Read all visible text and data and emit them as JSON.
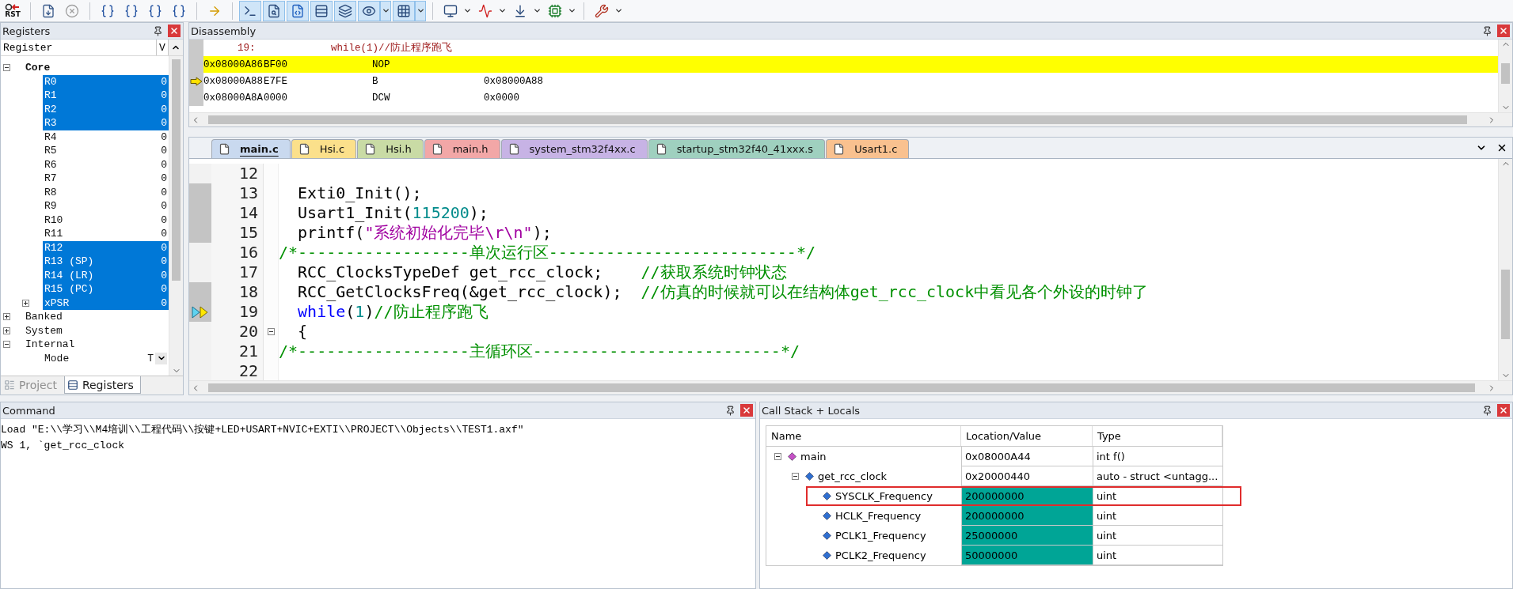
{
  "toolbar": [
    [
      {
        "kind": "rst",
        "label": "RST",
        "pressed": false
      }
    ],
    [
      {
        "kind": "reset",
        "pressed": false
      },
      {
        "kind": "stop",
        "pressed": false
      }
    ],
    [
      {
        "kind": "stepinto",
        "pressed": false
      },
      {
        "kind": "stepover",
        "pressed": false
      },
      {
        "kind": "stepout",
        "pressed": false
      },
      {
        "kind": "runcursor",
        "pressed": false
      }
    ],
    [
      {
        "kind": "shownext",
        "pressed": false
      }
    ],
    [
      {
        "kind": "command",
        "pressed": true
      },
      {
        "kind": "disassembly",
        "pressed": true
      },
      {
        "kind": "symbols",
        "pressed": true
      },
      {
        "kind": "registers",
        "pressed": true
      },
      {
        "kind": "callstack",
        "pressed": true
      },
      {
        "kind": "watch",
        "pressed": true
      },
      {
        "kind": "menu",
        "pressed": true
      },
      {
        "kind": "memory",
        "pressed": true
      },
      {
        "kind": "menu",
        "pressed": true
      }
    ],
    [
      {
        "kind": "serial",
        "pressed": false
      },
      {
        "kind": "menu",
        "pressed": false
      },
      {
        "kind": "analysis",
        "pressed": false
      },
      {
        "kind": "menu",
        "pressed": false
      },
      {
        "kind": "trace",
        "pressed": false
      },
      {
        "kind": "menu",
        "pressed": false
      },
      {
        "kind": "viewer",
        "pressed": false
      },
      {
        "kind": "menu",
        "pressed": false
      }
    ],
    [
      {
        "kind": "tools",
        "pressed": false
      },
      {
        "kind": "menu",
        "pressed": false
      }
    ]
  ],
  "registers": {
    "title": "Registers",
    "columns": [
      "Register",
      "V"
    ],
    "tree": [
      {
        "label": "Core",
        "selected": false,
        "expanded": true,
        "children": [
          {
            "label": "R0",
            "value": "0",
            "kind": "value",
            "selected": true
          },
          {
            "label": "R1",
            "value": "0",
            "kind": "value",
            "selected": true
          },
          {
            "label": "R2",
            "value": "0",
            "kind": "value",
            "selected": true
          },
          {
            "label": "R3",
            "value": "0",
            "kind": "value",
            "selected": true
          },
          {
            "label": "R4",
            "value": "0",
            "kind": "value",
            "selected": false
          },
          {
            "label": "R5",
            "value": "0",
            "kind": "value",
            "selected": false
          },
          {
            "label": "R6",
            "value": "0",
            "kind": "value",
            "selected": false
          },
          {
            "label": "R7",
            "value": "0",
            "kind": "value",
            "selected": false
          },
          {
            "label": "R8",
            "value": "0",
            "kind": "value",
            "selected": false
          },
          {
            "label": "R9",
            "value": "0",
            "kind": "value",
            "selected": false
          },
          {
            "label": "R10",
            "value": "0",
            "kind": "value",
            "selected": false
          },
          {
            "label": "R11",
            "value": "0",
            "kind": "value",
            "selected": false
          },
          {
            "label": "R12",
            "value": "0",
            "kind": "value",
            "selected": true
          },
          {
            "label": "R13 (SP)",
            "value": "0",
            "kind": "value",
            "selected": true
          },
          {
            "label": "R14 (LR)",
            "value": "0",
            "kind": "value",
            "selected": true
          },
          {
            "label": "R15 (PC)",
            "value": "0",
            "kind": "value",
            "selected": true
          },
          {
            "label": "xPSR",
            "value": "0",
            "kind": "value",
            "selected": true,
            "expanded": false
          }
        ]
      },
      {
        "label": "Banked",
        "selected": false,
        "expanded": false
      },
      {
        "label": "System",
        "selected": false,
        "expanded": false
      },
      {
        "label": "Internal",
        "selected": false,
        "expanded": true,
        "children": [
          {
            "label": "Mode",
            "value": "T",
            "kind": "dropdown",
            "selected": false
          }
        ]
      }
    ],
    "tabs": [
      {
        "label": "Project",
        "selected": false
      },
      {
        "label": "Registers",
        "selected": true
      }
    ]
  },
  "disassembly": {
    "title": "Disassembly",
    "source": {
      "line": "19:",
      "code": "while(1)//防止程序跑飞"
    },
    "rows": [
      {
        "address": "0x08000A86",
        "opcode": "BF00",
        "mnemonic": "NOP",
        "highlighted": true,
        "current": false
      },
      {
        "address": "0x08000A88",
        "opcode": "E7FE",
        "mnemonic": "B",
        "operand": "0x08000A88",
        "highlighted": false,
        "current": true
      },
      {
        "address": "0x08000A8A",
        "opcode": "0000",
        "mnemonic": "DCW",
        "operand": "0x0000",
        "highlighted": false,
        "current": false
      }
    ]
  },
  "editor": {
    "tabs": [
      {
        "label": "main.c",
        "color": "#c9d9ef",
        "selected": true
      },
      {
        "label": "Hsi.c",
        "color": "#fbe08b",
        "selected": false
      },
      {
        "label": "Hsi.h",
        "color": "#c9dba5",
        "selected": false
      },
      {
        "label": "main.h",
        "color": "#f2a7a7",
        "selected": false
      },
      {
        "label": "system_stm32f4xx.c",
        "color": "#c7b3e5",
        "selected": false
      },
      {
        "label": "startup_stm32f40_41xxx.s",
        "color": "#9fd0bf",
        "selected": false
      },
      {
        "label": "Usart1.c",
        "color": "#f9c18f",
        "selected": false
      }
    ],
    "lines": [
      {
        "number": "12",
        "executable": false,
        "current": false,
        "fold": false
      },
      {
        "number": "13",
        "executable": true,
        "current": false,
        "fold": false,
        "segments": [
          {
            "text": "  Exti0_Init();",
            "kind": "plain"
          }
        ]
      },
      {
        "number": "14",
        "executable": true,
        "current": false,
        "fold": false,
        "segments": [
          {
            "text": "  Usart1_Init(",
            "kind": "plain"
          },
          {
            "text": "115200",
            "kind": "number"
          },
          {
            "text": ");",
            "kind": "plain"
          }
        ]
      },
      {
        "number": "15",
        "executable": true,
        "current": false,
        "fold": false,
        "segments": [
          {
            "text": "  printf(",
            "kind": "plain"
          },
          {
            "text": "\"系统初始化完毕\\r\\n\"",
            "kind": "string"
          },
          {
            "text": ");",
            "kind": "plain"
          }
        ]
      },
      {
        "number": "16",
        "executable": false,
        "current": false,
        "fold": false,
        "segments": [
          {
            "text": "/*------------------单次运行区--------------------------*/",
            "kind": "comment"
          }
        ]
      },
      {
        "number": "17",
        "executable": false,
        "current": false,
        "fold": false,
        "segments": [
          {
            "text": "  RCC_ClocksTypeDef get_rcc_clock;    ",
            "kind": "plain"
          },
          {
            "text": "//获取系统时钟状态",
            "kind": "comment"
          }
        ]
      },
      {
        "number": "18",
        "executable": true,
        "current": false,
        "fold": false,
        "segments": [
          {
            "text": "  RCC_GetClocksFreq(&get_rcc_clock);  ",
            "kind": "plain"
          },
          {
            "text": "//仿真的时候就可以在结构体get_rcc_clock中看见各个外设的时钟了",
            "kind": "comment"
          }
        ]
      },
      {
        "number": "19",
        "executable": true,
        "current": true,
        "fold": false,
        "segments": [
          {
            "text": "  while",
            "kind": "keyword"
          },
          {
            "text": "(",
            "kind": "plain"
          },
          {
            "text": "1",
            "kind": "number"
          },
          {
            "text": ")",
            "kind": "plain"
          },
          {
            "text": "//防止程序跑飞",
            "kind": "comment"
          }
        ]
      },
      {
        "number": "20",
        "executable": false,
        "current": false,
        "fold": true,
        "segments": [
          {
            "text": "  {",
            "kind": "plain"
          }
        ]
      },
      {
        "number": "21",
        "executable": false,
        "current": false,
        "fold": false,
        "segments": [
          {
            "text": "/*------------------主循环区--------------------------*/",
            "kind": "comment"
          }
        ]
      },
      {
        "number": "22",
        "executable": false,
        "current": false,
        "fold": false
      }
    ]
  },
  "command": {
    "title": "Command",
    "lines": [
      "Load \"E:\\\\学习\\\\M4培训\\\\工程代码\\\\按键+LED+USART+NVIC+EXTI\\\\PROJECT\\\\Objects\\\\TEST1.axf\"",
      "WS 1, `get_rcc_clock"
    ]
  },
  "call_stack": {
    "title": "Call Stack + Locals",
    "columns": [
      "Name",
      "Location/Value",
      "Type"
    ],
    "rows": [
      {
        "name": "main",
        "value": "0x08000A44",
        "type": "int f()",
        "kind": "function",
        "expanded": true,
        "changed": false,
        "outlined": false,
        "children": [
          {
            "name": "get_rcc_clock",
            "value": "0x20000440",
            "type": "auto - struct <untagg...",
            "kind": "struct",
            "expanded": true,
            "changed": false,
            "outlined": false,
            "children": [
              {
                "name": "SYSCLK_Frequency",
                "value": "200000000",
                "type": "uint",
                "kind": "member",
                "changed": true,
                "outlined": true
              },
              {
                "name": "HCLK_Frequency",
                "value": "200000000",
                "type": "uint",
                "kind": "member",
                "changed": true,
                "outlined": false
              },
              {
                "name": "PCLK1_Frequency",
                "value": "25000000",
                "type": "uint",
                "kind": "member",
                "changed": true,
                "outlined": false
              },
              {
                "name": "PCLK2_Frequency",
                "value": "50000000",
                "type": "uint",
                "kind": "member",
                "changed": true,
                "outlined": false
              }
            ]
          }
        ]
      }
    ]
  }
}
